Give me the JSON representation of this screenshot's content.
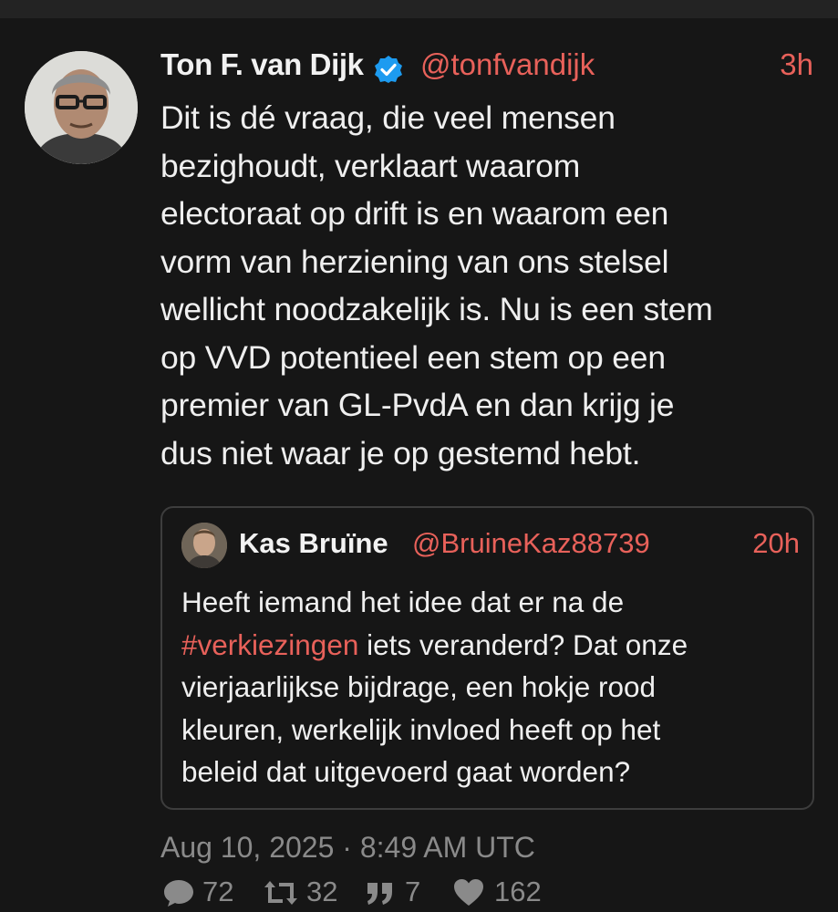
{
  "tweet": {
    "author": {
      "name": "Ton F. van Dijk",
      "handle": "@tonfvandijk",
      "verified": true
    },
    "time": "3h",
    "text": "Dit is dé vraag, die veel mensen\nbezighoudt, verklaart waarom\nelectoraat op drift is en waarom een\nvorm van herziening van ons stelsel\nwellicht noodzakelijk is. Nu is een stem\nop VVD potentieel een stem op een\npremier van GL-PvdA en dan krijg je\ndus niet waar je op gestemd hebt.",
    "quote": {
      "author": {
        "name": "Kas Bruïne",
        "handle": "@BruineKaz88739"
      },
      "time": "20h",
      "lines": {
        "l1": "Heeft iemand het idee dat er na de",
        "hashtag": "#verkiezingen",
        "l2_rest": " iets veranderd? Dat onze",
        "l3": "vierjaarlijkse bijdrage, een hokje rood",
        "l4": "kleuren, werkelijk invloed heeft op het",
        "l5": "beleid dat uitgevoerd gaat worden?"
      }
    },
    "date": "Aug 10, 2025 · 8:49 AM UTC",
    "stats": {
      "replies": "72",
      "retweets": "32",
      "quotes": "7",
      "likes": "162"
    }
  },
  "colors": {
    "background": "#161616",
    "accent": "#e8615a",
    "muted": "#8a8a8a",
    "verified": "#1d9bf0"
  }
}
